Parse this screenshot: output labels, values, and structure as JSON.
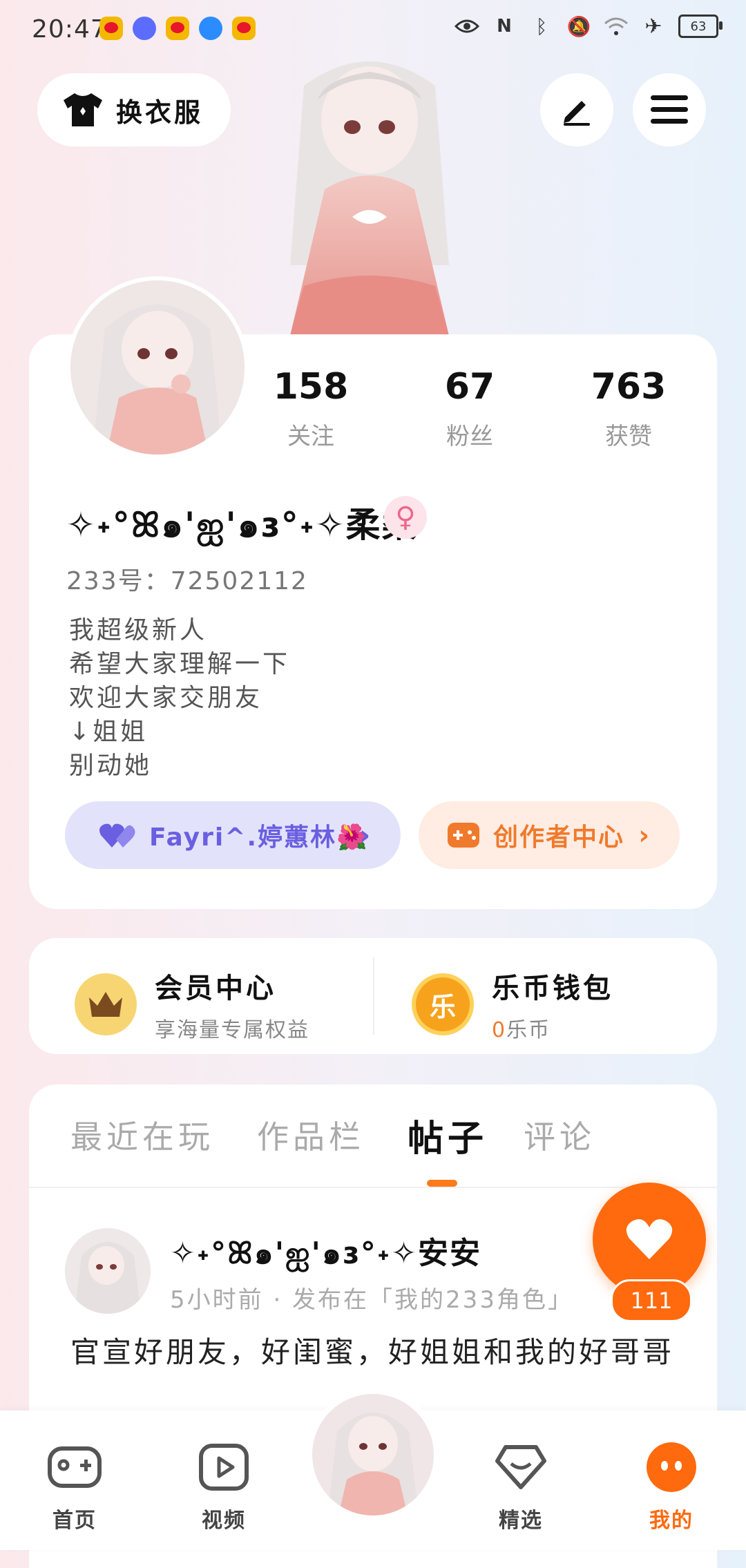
{
  "status_bar": {
    "time": "20:47",
    "battery": "63"
  },
  "header": {
    "outfit_label": "换衣服"
  },
  "profile": {
    "stats": [
      {
        "value": "158",
        "label": "关注"
      },
      {
        "value": "67",
        "label": "粉丝"
      },
      {
        "value": "763",
        "label": "获赞"
      }
    ],
    "nickname": "✧˖°ꕤ๑'ஐ'๑ɜ°˖✧柔柔",
    "uid": "233号：72502112",
    "bio_lines": [
      "我超级新人",
      "希望大家理解一下",
      "欢迎大家交朋友",
      "↓姐姐",
      "别动她"
    ],
    "guild_label": "Fayri^.婷蕙林🌺",
    "creator_label": "创作者中心"
  },
  "vip": {
    "title": "会员中心",
    "subtitle": "享海量专属权益"
  },
  "wallet": {
    "title": "乐币钱包",
    "amount": "0",
    "unit": "乐币",
    "coin_char": "乐"
  },
  "tabs": [
    "最近在玩",
    "作品栏",
    "帖子",
    "评论"
  ],
  "active_tab": "帖子",
  "post": {
    "author": "✧˖°ꕤ๑'ஐ'๑ɜ°˖✧安安",
    "meta": "5小时前 · 发布在「我的233角色」",
    "text": "官宣好朋友，好闺蜜，好姐姐和我的好哥哥"
  },
  "fab": {
    "count": "111"
  },
  "nav": [
    {
      "label": "首页",
      "icon": "gamepad-icon"
    },
    {
      "label": "视频",
      "icon": "play-icon"
    },
    {
      "label": "精选",
      "icon": "heart-diamond-icon"
    },
    {
      "label": "我的",
      "icon": "face-icon"
    }
  ],
  "colors": {
    "accent": "#ff6a0e",
    "guild": "#6a5fe0",
    "creator": "#f07a2c",
    "female": "#f0668a"
  }
}
